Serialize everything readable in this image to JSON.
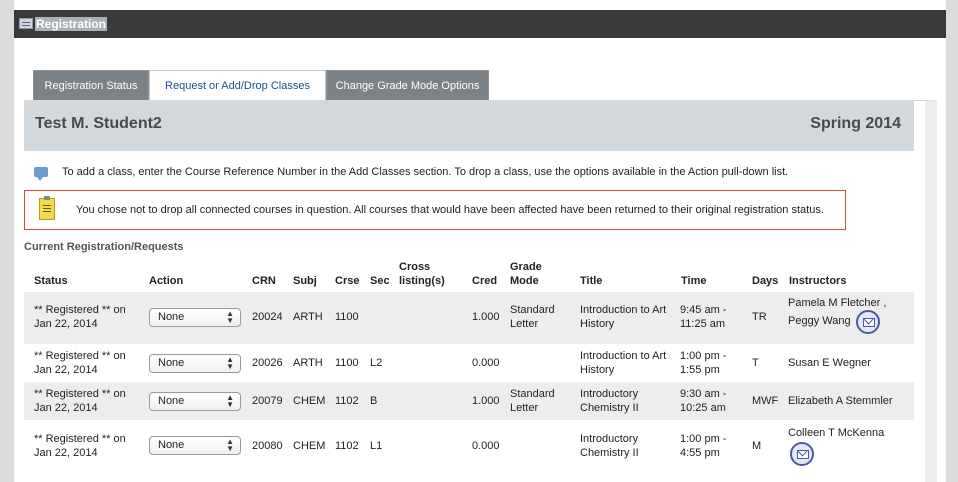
{
  "window": {
    "title": "Registration"
  },
  "tabs": [
    {
      "label": "Registration Status",
      "active": false
    },
    {
      "label": "Request or Add/Drop Classes",
      "active": true
    },
    {
      "label": "Change Grade Mode Options",
      "active": false
    }
  ],
  "student": {
    "name": "Test M. Student2",
    "term": "Spring 2014"
  },
  "info": {
    "text": "To add a class, enter the Course Reference Number in the Add Classes section. To drop a class, use the options available in the Action pull-down list."
  },
  "alert": {
    "text": "You chose not to drop all connected courses in question. All courses that would have been affected have been returned to their original registration status."
  },
  "section": {
    "heading": "Current Registration/Requests"
  },
  "table": {
    "headers": {
      "status": "Status",
      "action": "Action",
      "crn": "CRN",
      "subj": "Subj",
      "crse": "Crse",
      "sec": "Sec",
      "cross_1": "Cross",
      "cross_2": "listing(s)",
      "cred": "Cred",
      "grade_1": "Grade",
      "grade_2": "Mode",
      "title": "Title",
      "time": "Time",
      "days": "Days",
      "instructors": "Instructors"
    },
    "rows": [
      {
        "status_1": "** Registered ** on",
        "status_2": "Jan 22, 2014",
        "action": "None",
        "crn": "20024",
        "subj": "ARTH",
        "crse": "1100",
        "sec": "",
        "cred": "1.000",
        "grade_1": "Standard",
        "grade_2": "Letter",
        "title_1": "Introduction to Art",
        "title_2": "History",
        "time_1": "9:45 am -",
        "time_2": "11:25 am",
        "days": "TR",
        "instr_1": "Pamela M Fletcher ,",
        "instr_2": "Peggy Wang"
      },
      {
        "status_1": "** Registered ** on",
        "status_2": "Jan 22, 2014",
        "action": "None",
        "crn": "20026",
        "subj": "ARTH",
        "crse": "1100",
        "sec": "L2",
        "cred": "0.000",
        "grade_1": "",
        "grade_2": "",
        "title_1": "Introduction to Art",
        "title_2": "History",
        "time_1": "1:00 pm -",
        "time_2": "1:55 pm",
        "days": "T",
        "instr_1": "Susan E Wegner",
        "instr_2": ""
      },
      {
        "status_1": "** Registered ** on",
        "status_2": "Jan 22, 2014",
        "action": "None",
        "crn": "20079",
        "subj": "CHEM",
        "crse": "1102",
        "sec": "B",
        "cred": "1.000",
        "grade_1": "Standard",
        "grade_2": "Letter",
        "title_1": "Introductory",
        "title_2": "Chemistry II",
        "time_1": "9:30 am -",
        "time_2": "10:25 am",
        "days": "MWF",
        "instr_1": "Elizabeth A Stemmler",
        "instr_2": ""
      },
      {
        "status_1": "** Registered ** on",
        "status_2": "Jan 22, 2014",
        "action": "None",
        "crn": "20080",
        "subj": "CHEM",
        "crse": "1102",
        "sec": "L1",
        "cred": "0.000",
        "grade_1": "",
        "grade_2": "",
        "title_1": "Introductory",
        "title_2": "Chemistry II",
        "time_1": "1:00 pm -",
        "time_2": "4:55 pm",
        "days": "M",
        "instr_1": "Colleen T McKenna",
        "instr_2": ""
      }
    ]
  }
}
